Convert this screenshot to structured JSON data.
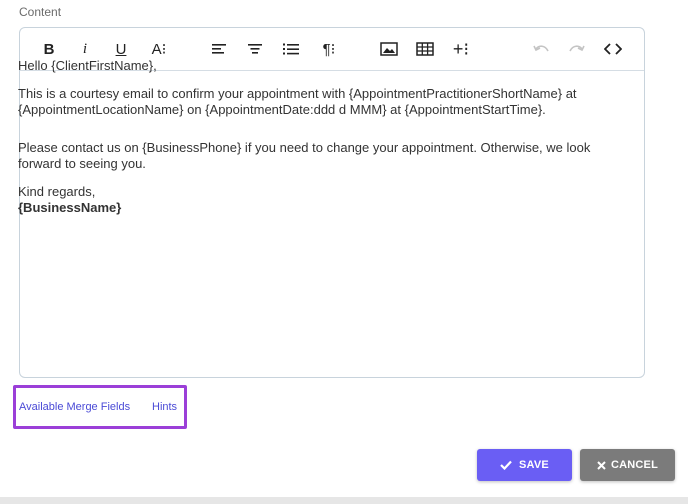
{
  "content_label": "Content",
  "toolbar": {
    "bold": "B",
    "italic": "i",
    "underline": "U",
    "font_size": "A⁝",
    "paragraph": "¶⁝",
    "insert_more": "+⁝"
  },
  "email": {
    "greeting": "Hello {ClientFirstName},",
    "line1a": "This is a courtesy email to confirm your appointment with {AppointmentPractitionerShortName} at",
    "line1b": "{AppointmentLocationName} on {AppointmentDate:ddd d MMM} at {AppointmentStartTime}.",
    "line2a": "Please contact us on {BusinessPhone} if you need to change your appointment. Otherwise, we look",
    "line2b": "forward to seeing you.",
    "signoff": "Kind regards,",
    "signature": "{BusinessName}"
  },
  "links": {
    "merge_fields": "Available Merge Fields",
    "hints": "Hints"
  },
  "buttons": {
    "save": "SAVE",
    "cancel": "CANCEL"
  },
  "colors": {
    "save_bg": "#6a5ef4",
    "cancel_bg": "#7b7b7b",
    "highlight_border": "#9b3fd8",
    "link": "#4a4ad6"
  }
}
